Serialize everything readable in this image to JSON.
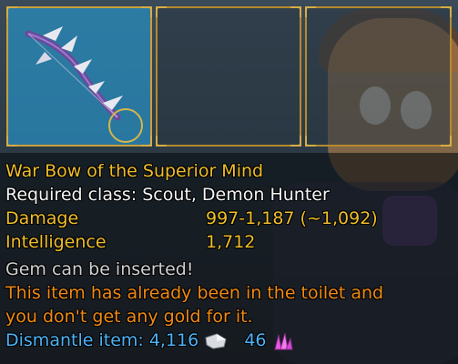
{
  "item": {
    "name": "War Bow of the Superior Mind",
    "required_class": "Required class: Scout, Demon Hunter",
    "stats": [
      {
        "label": "Damage",
        "value": "997-1,187 (~1,092)"
      },
      {
        "label": "Intelligence",
        "value": "1,712"
      }
    ],
    "gem_note": "Gem can be inserted!",
    "toilet_note_line1": "This item has already been in the toilet and",
    "toilet_note_line2": "you don't get any gold for it.",
    "dismantle_label": "Dismantle item:",
    "dismantle_metal": "4,116",
    "dismantle_crystal": "46"
  },
  "colors": {
    "name": "#f0be2a",
    "stat_label": "#f0be2a",
    "warning": "#f08a14",
    "dismantle": "#4cb2f6",
    "crystal": "#ec56e6",
    "slot_active": "#2a8cbe"
  },
  "icons": [
    "war-bow-icon",
    "gem-socket-icon",
    "metal-icon",
    "crystal-icon"
  ]
}
